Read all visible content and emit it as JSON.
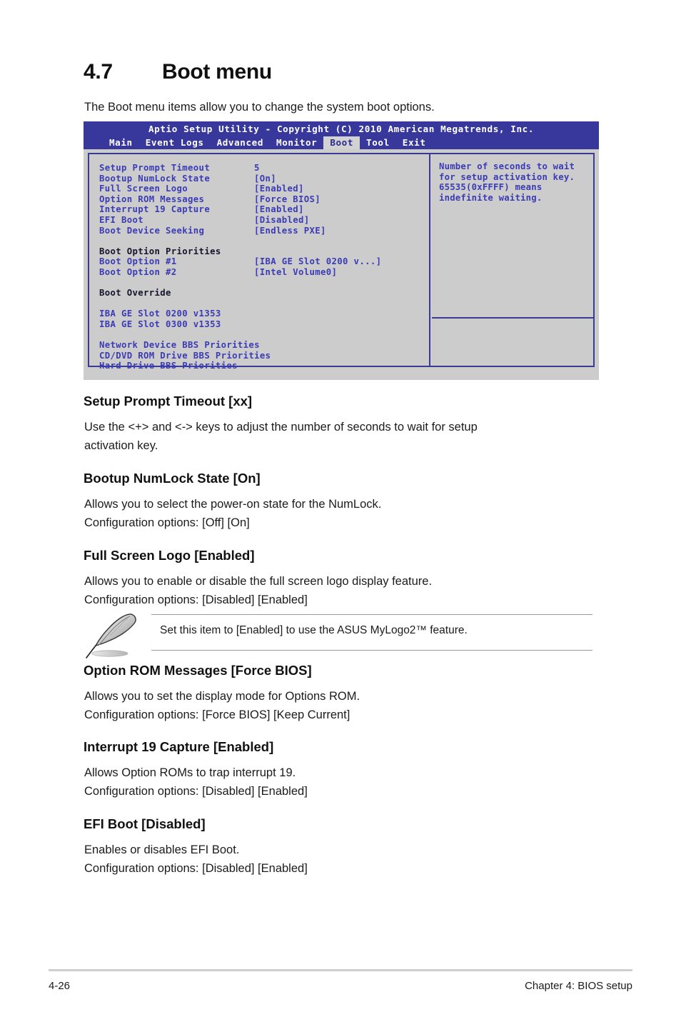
{
  "section": {
    "number": "4.7",
    "title": "Boot menu",
    "intro": "The Boot menu items allow you to change the system boot options."
  },
  "bios": {
    "title": "Aptio Setup Utility - Copyright (C) 2010 American Megatrends, Inc.",
    "tabs": [
      {
        "label": "Main",
        "active": false
      },
      {
        "label": "Event Logs",
        "active": false
      },
      {
        "label": "Advanced",
        "active": false
      },
      {
        "label": "Monitor",
        "active": false
      },
      {
        "label": "Boot",
        "active": true
      },
      {
        "label": "Tool",
        "active": false
      },
      {
        "label": "Exit",
        "active": false
      }
    ],
    "items": [
      {
        "label": "Setup Prompt Timeout",
        "value": "5"
      },
      {
        "label": "Bootup NumLock State",
        "value": "[On]"
      },
      {
        "label": "Full Screen Logo",
        "value": "[Enabled]"
      },
      {
        "label": "Option ROM Messages",
        "value": "[Force BIOS]"
      },
      {
        "label": "Interrupt 19 Capture",
        "value": "[Enabled]"
      },
      {
        "label": "EFI Boot",
        "value": "[Disabled]"
      },
      {
        "label": "Boot Device Seeking",
        "value": "[Endless PXE]"
      }
    ],
    "priorities_heading": "Boot Option Priorities",
    "priorities": [
      {
        "label": "Boot Option #1",
        "value": "[IBA GE Slot 0200 v...]"
      },
      {
        "label": "Boot Option #2",
        "value": "[Intel Volume0]"
      }
    ],
    "override_heading": "Boot Override",
    "override_items": [
      "IBA GE Slot 0200 v1353",
      "IBA GE Slot 0300 v1353"
    ],
    "bbs_items": [
      "Network Device BBS Priorities",
      "CD/DVD ROM Drive BBS Priorities",
      "Hard Drive BBS Priorities"
    ],
    "help": "Number of seconds to wait for setup activation key.\n65535(0xFFFF) means indefinite waiting.",
    "colors": {
      "header_bg": "#38389c",
      "panel_bg": "#cccccc",
      "border": "#3b3b96",
      "text_blue": "#3b3bb5",
      "active_tab_bg": "#d2d2d2"
    }
  },
  "sections": [
    {
      "heading": "Setup Prompt Timeout [xx]",
      "body": "Use the <+> and <-> keys to adjust the number of seconds to wait for setup\nactivation key."
    },
    {
      "heading": "Bootup NumLock State [On]",
      "body": "Allows you to select the power-on state for the NumLock.\nConfiguration options: [Off] [On]"
    },
    {
      "heading": "Full Screen Logo [Enabled]",
      "body": "Allows you to enable or disable the full screen logo display feature.\nConfiguration options: [Disabled] [Enabled]"
    },
    {
      "heading": "Option ROM Messages [Force BIOS]",
      "body": "Allows you to set the display mode for Options ROM.\nConfiguration options: [Force BIOS] [Keep Current]"
    },
    {
      "heading": "Interrupt 19 Capture [Enabled]",
      "body": "Allows Option ROMs to trap interrupt 19.\nConfiguration options: [Disabled] [Enabled]"
    },
    {
      "heading": "EFI Boot [Disabled]",
      "body": "Enables or disables EFI Boot.\nConfiguration options: [Disabled] [Enabled]"
    }
  ],
  "note": {
    "icon": "feather-quill-icon",
    "text": "Set this item to [Enabled] to use the ASUS MyLogo2™ feature."
  },
  "footer": {
    "page_number": "4-26",
    "chapter": "Chapter 4: BIOS setup"
  }
}
